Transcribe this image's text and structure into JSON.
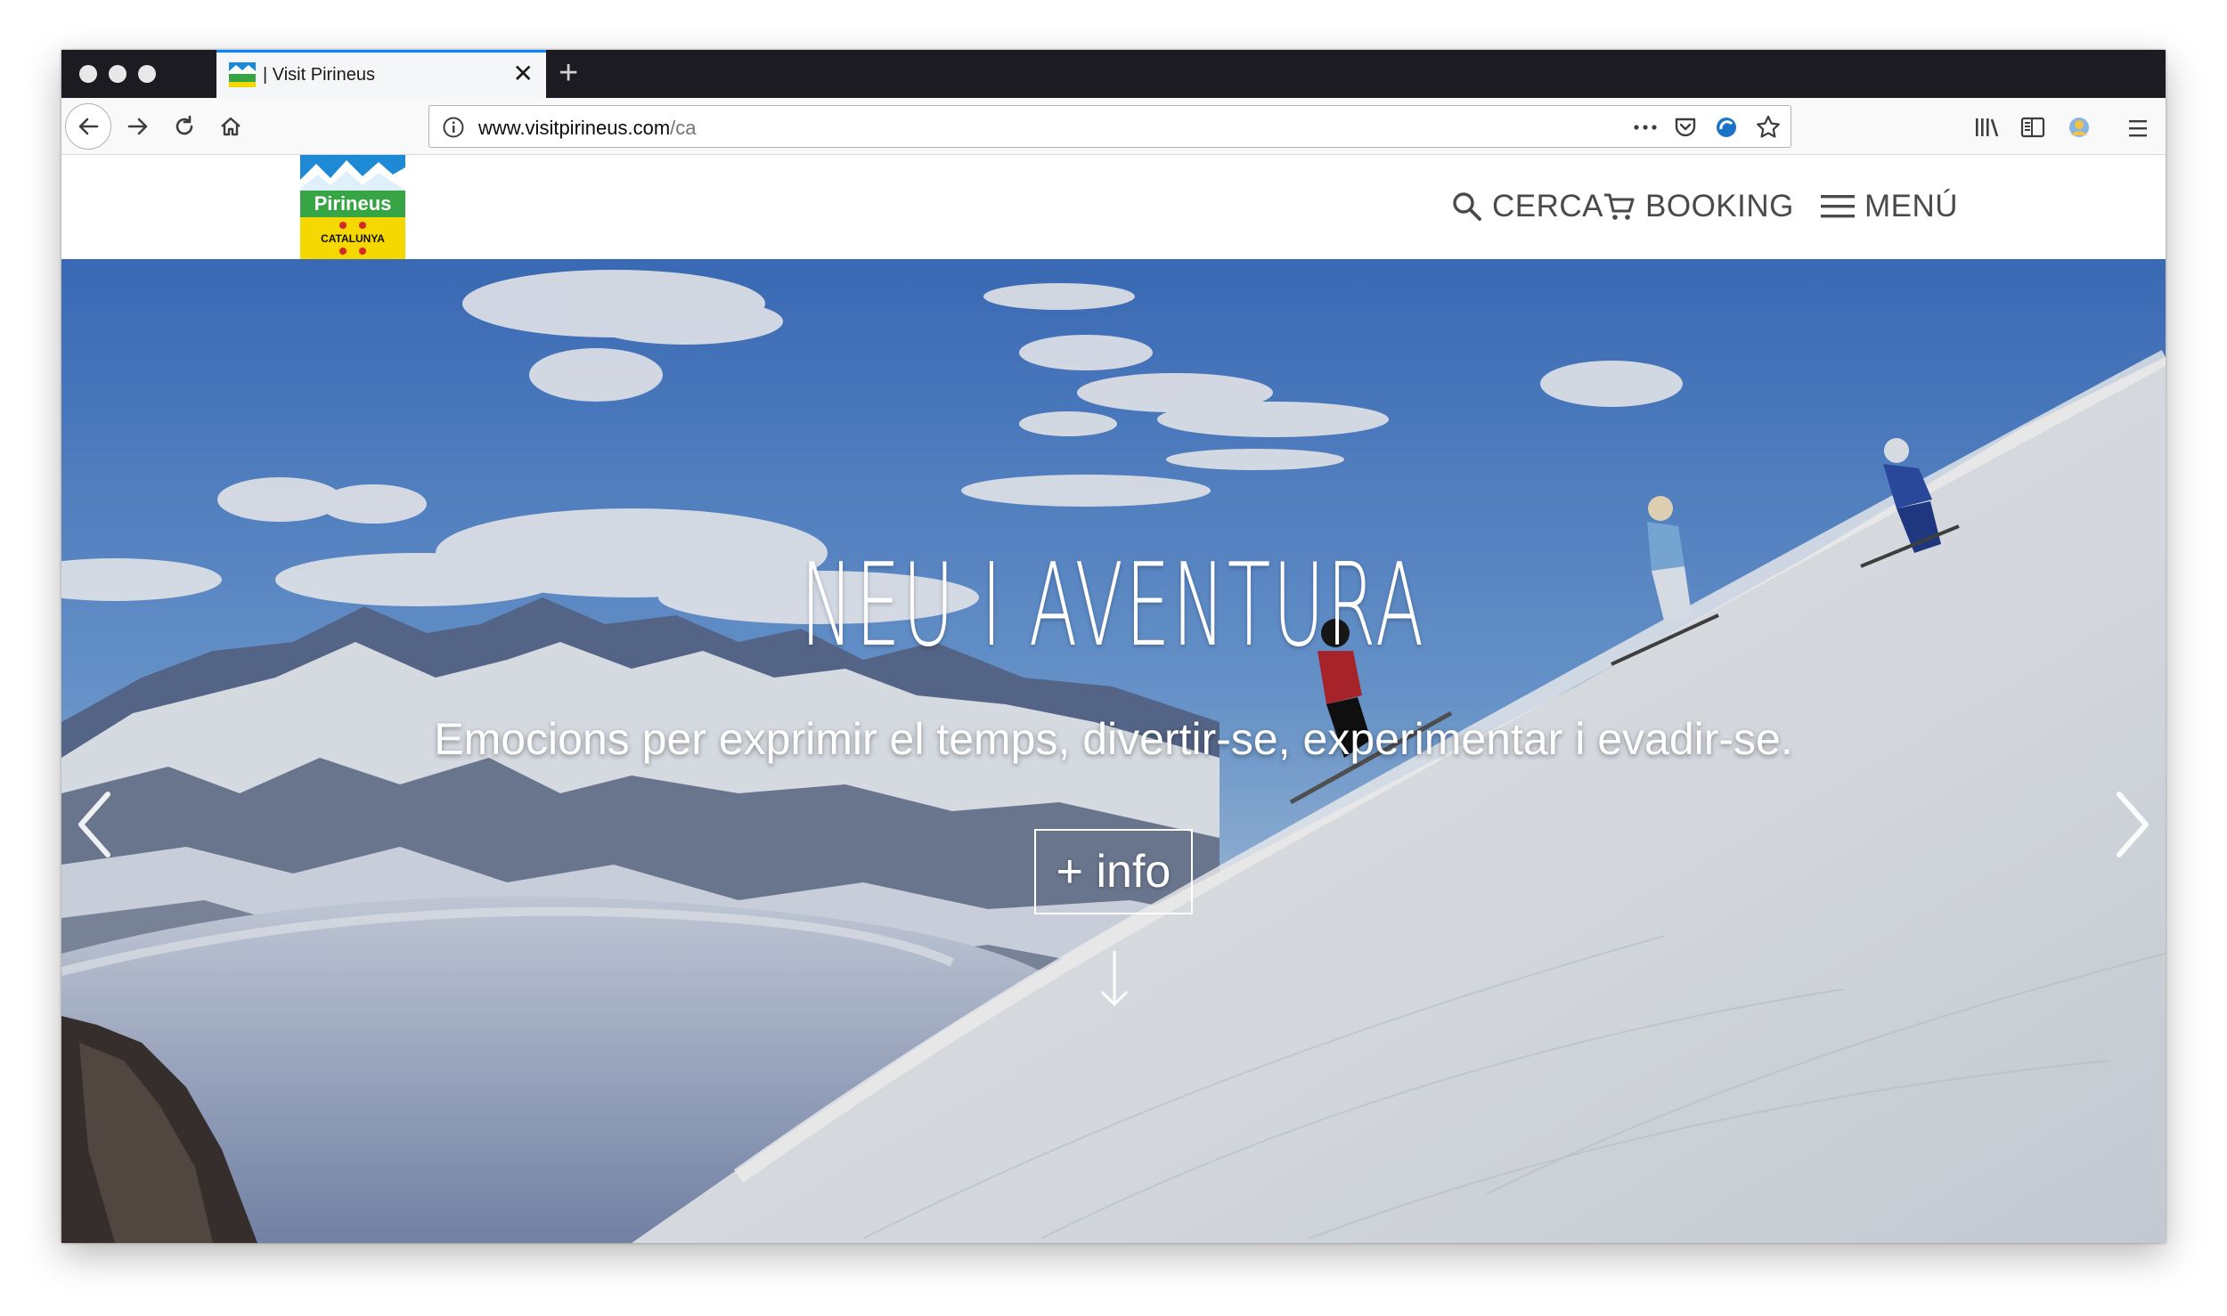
{
  "browser": {
    "tab": {
      "title": "| Visit Pirineus",
      "close_glyph": "✕"
    },
    "new_tab_glyph": "+",
    "url": {
      "host": "www.visitpirineus.com",
      "path": "/ca"
    },
    "icons": [
      "back-icon",
      "forward-icon",
      "reload-icon",
      "home-icon",
      "info-icon",
      "more-icon",
      "pocket-icon",
      "extension-icon",
      "bookmark-star-icon",
      "library-icon",
      "sidebar-icon",
      "account-icon",
      "menu-icon"
    ]
  },
  "site": {
    "logo": {
      "top_text": "Pirineus",
      "bottom_text": "CATALUNYA"
    },
    "nav": {
      "search_label": "CERCA",
      "booking_label": "BOOKING",
      "menu_label": "MENÚ"
    },
    "hero": {
      "title": "NEU I AVENTURA",
      "subtitle": "Emocions per exprimir el temps, divertir-se, experimentar i evadir-se.",
      "cta_label": "+ info"
    }
  },
  "colors": {
    "accent_tab": "#0a84ff",
    "nav_text": "#4a4a4a",
    "logo_blue": "#1e8ad6",
    "logo_green": "#37a544",
    "logo_yellow": "#f5d800"
  }
}
